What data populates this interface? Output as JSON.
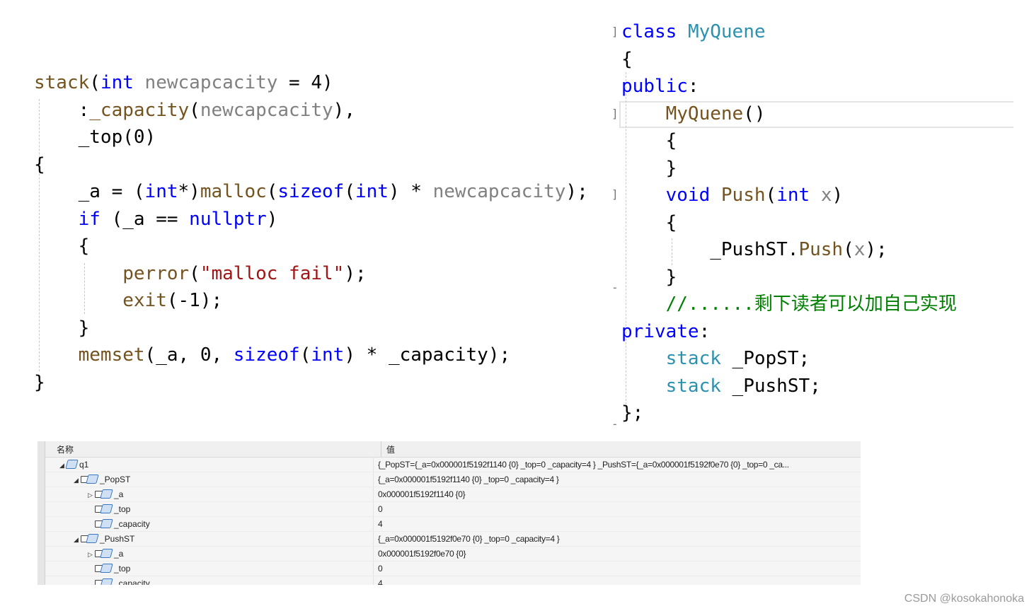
{
  "left_code": [
    [
      [
        "fn",
        "stack"
      ],
      [
        "",
        "("
      ],
      [
        "kw",
        "int"
      ],
      [
        "par",
        " newcapcacity"
      ],
      [
        "",
        " = 4)"
      ]
    ],
    [
      [
        "",
        "    :"
      ],
      [
        "fn",
        "_capacity"
      ],
      [
        "",
        "("
      ],
      [
        "par",
        "newcapcacity"
      ],
      [
        "",
        "),"
      ]
    ],
    [
      [
        "",
        "    _top(0)"
      ]
    ],
    [
      [
        "",
        "{"
      ]
    ],
    [
      [
        "",
        "    _a = ("
      ],
      [
        "kw",
        "int"
      ],
      [
        "",
        "*)"
      ],
      [
        "fn",
        "malloc"
      ],
      [
        "",
        "("
      ],
      [
        "kw",
        "sizeof"
      ],
      [
        "",
        "("
      ],
      [
        "kw",
        "int"
      ],
      [
        "",
        ") * "
      ],
      [
        "par",
        "newcapcacity"
      ],
      [
        "",
        ");"
      ]
    ],
    [
      [
        "",
        "    "
      ],
      [
        "kw",
        "if"
      ],
      [
        "",
        " (_a == "
      ],
      [
        "kw",
        "nullptr"
      ],
      [
        "",
        ")"
      ]
    ],
    [
      [
        "",
        "    {"
      ]
    ],
    [
      [
        "",
        "        "
      ],
      [
        "fn",
        "perror"
      ],
      [
        "",
        "("
      ],
      [
        "str",
        "\"malloc fail\""
      ],
      [
        "",
        ");"
      ]
    ],
    [
      [
        "",
        "        "
      ],
      [
        "fn",
        "exit"
      ],
      [
        "",
        "(-1);"
      ]
    ],
    [
      [
        "",
        "    }"
      ]
    ],
    [
      [
        "",
        "    "
      ],
      [
        "fn",
        "memset"
      ],
      [
        "",
        "(_a, 0, "
      ],
      [
        "kw",
        "sizeof"
      ],
      [
        "",
        "("
      ],
      [
        "kw",
        "int"
      ],
      [
        "",
        ") * _capacity);"
      ]
    ],
    [
      [
        "",
        "}"
      ]
    ]
  ],
  "right_code": [
    [
      [
        "kw",
        "class"
      ],
      [
        "",
        " "
      ],
      [
        "typ",
        "MyQuene"
      ]
    ],
    [
      [
        "",
        "{"
      ]
    ],
    [
      [
        "kw",
        "public"
      ],
      [
        "",
        ":"
      ]
    ],
    [
      [
        "",
        "    "
      ],
      [
        "fn",
        "MyQuene"
      ],
      [
        "",
        "()"
      ]
    ],
    [
      [
        "",
        "    {"
      ]
    ],
    [
      [
        "",
        "    }"
      ]
    ],
    [
      [
        "",
        "    "
      ],
      [
        "kw",
        "void"
      ],
      [
        "",
        " "
      ],
      [
        "fn",
        "Push"
      ],
      [
        "",
        "("
      ],
      [
        "kw",
        "int"
      ],
      [
        "",
        " "
      ],
      [
        "par",
        "x"
      ],
      [
        "",
        ")"
      ]
    ],
    [
      [
        "",
        "    {"
      ]
    ],
    [
      [
        "",
        "        _PushST."
      ],
      [
        "fn",
        "Push"
      ],
      [
        "",
        "("
      ],
      [
        "par",
        "x"
      ],
      [
        "",
        ");"
      ]
    ],
    [
      [
        "",
        "    }"
      ]
    ],
    [
      [
        "cmt",
        "    //......"
      ],
      [
        "cmt-cjk",
        "剩下读者可以加自己实现"
      ]
    ],
    [
      [
        "kw",
        "private"
      ],
      [
        "",
        ":"
      ]
    ],
    [
      [
        "",
        "    "
      ],
      [
        "typ",
        "stack"
      ],
      [
        "",
        " _PopST;"
      ]
    ],
    [
      [
        "",
        "    "
      ],
      [
        "typ",
        "stack"
      ],
      [
        "",
        " _PushST;"
      ]
    ],
    [
      [
        "",
        "};"
      ]
    ]
  ],
  "watch": {
    "col_name": "名称",
    "col_value": "值",
    "rows": [
      {
        "depth": 0,
        "toggle": "expanded",
        "icon": "object-icon",
        "locked": false,
        "name": "q1",
        "value": "{_PopST={_a=0x000001f5192f1140 {0} _top=0 _capacity=4 } _PushST={_a=0x000001f5192f0e70 {0} _top=0 _ca..."
      },
      {
        "depth": 1,
        "toggle": "expanded",
        "icon": "object-icon",
        "locked": true,
        "name": "_PopST",
        "value": "{_a=0x000001f5192f1140 {0} _top=0 _capacity=4 }"
      },
      {
        "depth": 2,
        "toggle": "collapsed",
        "icon": "object-icon",
        "locked": true,
        "name": "_a",
        "value": "0x000001f5192f1140 {0}"
      },
      {
        "depth": 2,
        "toggle": "none",
        "icon": "object-icon",
        "locked": true,
        "name": "_top",
        "value": "0"
      },
      {
        "depth": 2,
        "toggle": "none",
        "icon": "object-icon",
        "locked": true,
        "name": "_capacity",
        "value": "4"
      },
      {
        "depth": 1,
        "toggle": "expanded",
        "icon": "object-icon",
        "locked": true,
        "name": "_PushST",
        "value": "{_a=0x000001f5192f0e70 {0} _top=0 _capacity=4 }"
      },
      {
        "depth": 2,
        "toggle": "collapsed",
        "icon": "object-icon",
        "locked": true,
        "name": "_a",
        "value": "0x000001f5192f0e70 {0}"
      },
      {
        "depth": 2,
        "toggle": "none",
        "icon": "object-icon",
        "locked": true,
        "name": "_top",
        "value": "0"
      },
      {
        "depth": 2,
        "toggle": "none",
        "icon": "object-icon",
        "locked": true,
        "name": "_capacity",
        "value": "4"
      }
    ]
  },
  "watermark": "CSDN @kosokahonoka",
  "colors": {
    "keyword": "#0000ff",
    "function": "#74531f",
    "parameter": "#808080",
    "string": "#a31515",
    "type": "#2b91af",
    "comment": "#008000"
  }
}
